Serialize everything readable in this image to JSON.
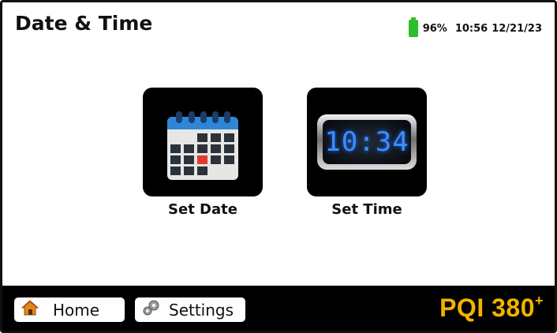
{
  "header": {
    "title": "Date & Time",
    "battery": "96%",
    "time": "10:56",
    "date": "12/21/23",
    "battery_color": "#2bc02b"
  },
  "tiles": [
    {
      "label": "Set Date",
      "icon": "calendar-icon"
    },
    {
      "label": "Set Time",
      "icon": "digital-clock-icon",
      "display": "10:34"
    }
  ],
  "bottom_bar": {
    "home_label": "Home",
    "settings_label": "Settings",
    "brand": "PQI 380",
    "brand_sup": "+",
    "brand_color": "#f3b300"
  }
}
